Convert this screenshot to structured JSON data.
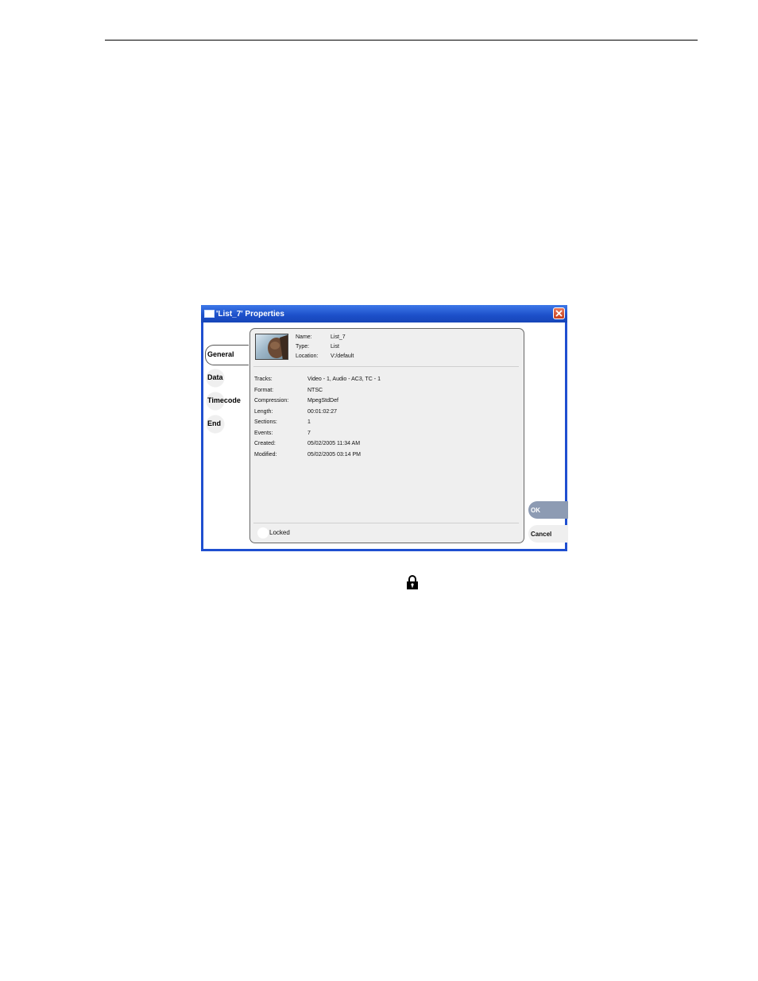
{
  "dialog": {
    "title": "'List_7' Properties",
    "tabs": [
      "General",
      "Data",
      "Timecode",
      "End"
    ],
    "header_fields": [
      {
        "label": "Name:",
        "value": "List_7"
      },
      {
        "label": "Type:",
        "value": "List"
      },
      {
        "label": "Location:",
        "value": "V:/default"
      }
    ],
    "fields": [
      {
        "label": "Tracks:",
        "value": "Video - 1, Audio - AC3, TC - 1"
      },
      {
        "label": "Format:",
        "value": "NTSC"
      },
      {
        "label": "Compression:",
        "value": "MpegStdDef"
      },
      {
        "label": "Length:",
        "value": "00:01:02:27"
      },
      {
        "label": "Sections:",
        "value": "1"
      },
      {
        "label": "Events:",
        "value": "7"
      },
      {
        "label": "Created:",
        "value": "05/02/2005 11:34 AM"
      },
      {
        "label": "Modified:",
        "value": "05/02/2005 03:14 PM"
      }
    ],
    "locked_label": "Locked",
    "ok_label": "OK",
    "cancel_label": "Cancel"
  },
  "icons": {
    "close": "close-icon",
    "lock": "lock-icon",
    "window": "window-icon"
  },
  "colors": {
    "titlebar": "#1f4fd0",
    "ok_button": "#8d9bb3",
    "close_button": "#c7401e"
  }
}
